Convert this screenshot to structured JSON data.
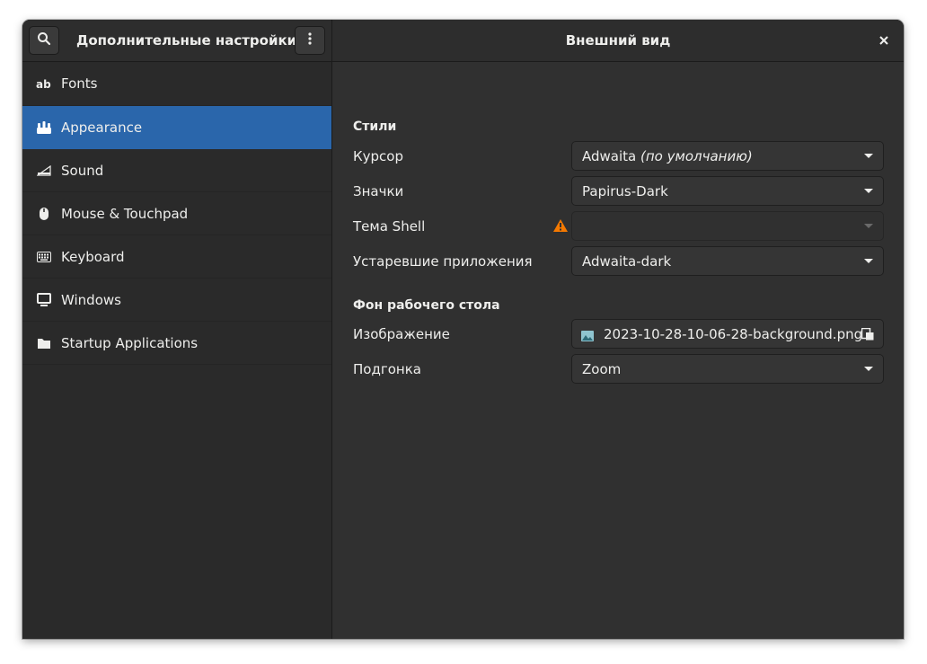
{
  "header": {
    "sidebar_title": "Дополнительные настройки",
    "main_title": "Внешний вид",
    "search_icon": "search-icon",
    "menu_icon": "vertical-dots-icon",
    "close_icon": "close-icon"
  },
  "sidebar": {
    "items": [
      {
        "label": "Fonts",
        "icon": "fonts-icon",
        "active": false
      },
      {
        "label": "Appearance",
        "icon": "appearance-icon",
        "active": true
      },
      {
        "label": "Sound",
        "icon": "sound-icon",
        "active": false
      },
      {
        "label": "Mouse & Touchpad",
        "icon": "mouse-icon",
        "active": false
      },
      {
        "label": "Keyboard",
        "icon": "keyboard-icon",
        "active": false
      },
      {
        "label": "Windows",
        "icon": "windows-icon",
        "active": false
      },
      {
        "label": "Startup Applications",
        "icon": "folder-icon",
        "active": false
      }
    ]
  },
  "main": {
    "styles_section": "Стили",
    "cursor_label": "Курсор",
    "cursor_value": "Adwaita",
    "cursor_value_note": "(по умолчанию)",
    "icons_label": "Значки",
    "icons_value": "Papirus-Dark",
    "shell_label": "Тема Shell",
    "shell_value": "",
    "legacy_label": "Устаревшие приложения",
    "legacy_value": "Adwaita-dark",
    "background_section": "Фон рабочего стола",
    "image_label": "Изображение",
    "image_value": "2023-10-28-10-06-28-background.png",
    "fit_label": "Подгонка",
    "fit_value": "Zoom"
  },
  "colors": {
    "window_bg": "#303030",
    "sidebar_bg": "#2a2a2a",
    "accent": "#2a66ab",
    "warning": "#f57900",
    "text": "#eeeeec"
  }
}
